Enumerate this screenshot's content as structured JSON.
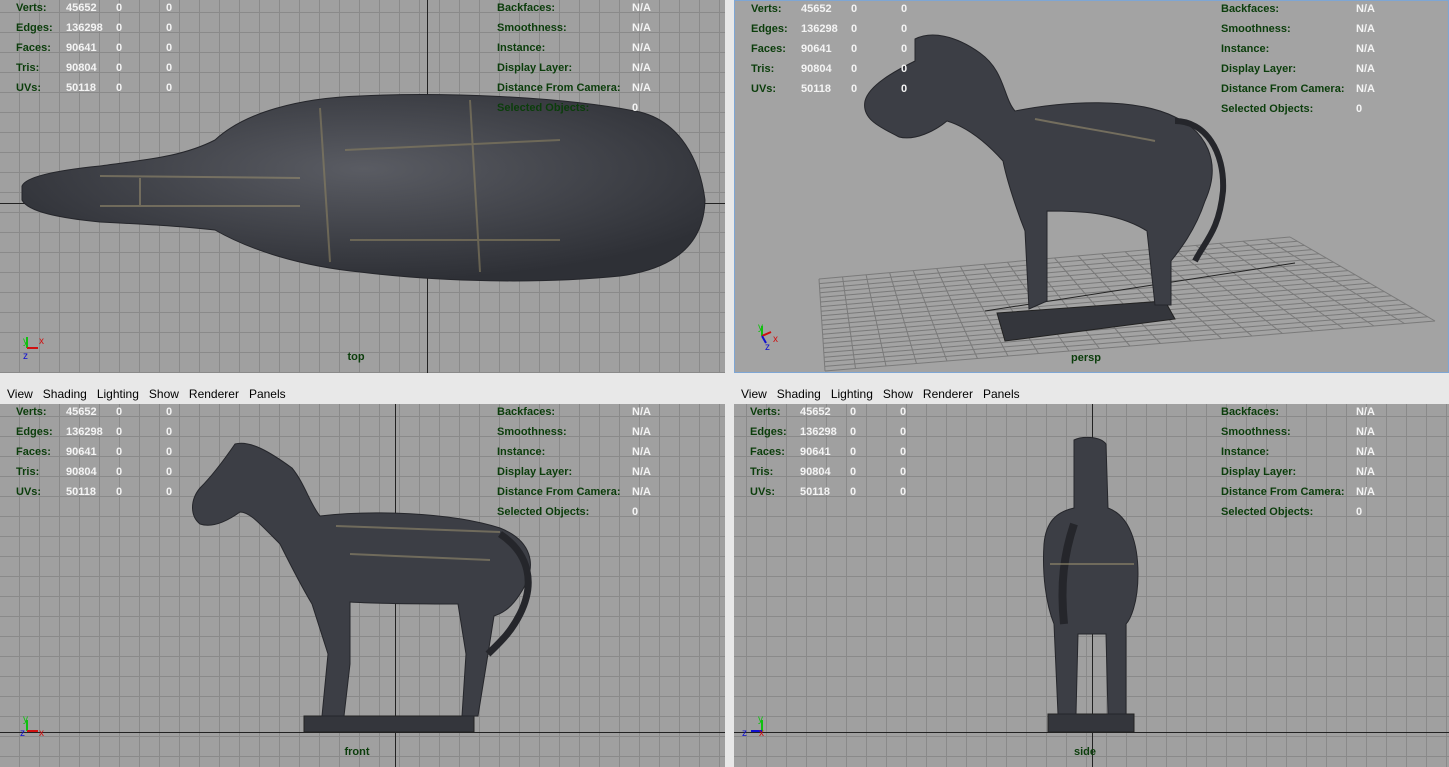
{
  "menu": [
    "View",
    "Shading",
    "Lighting",
    "Show",
    "Renderer",
    "Panels"
  ],
  "hud_left": [
    {
      "label": "Verts:",
      "v1": "45652",
      "v2": "0",
      "v3": "0"
    },
    {
      "label": "Edges:",
      "v1": "136298",
      "v2": "0",
      "v3": "0"
    },
    {
      "label": "Faces:",
      "v1": "90641",
      "v2": "0",
      "v3": "0"
    },
    {
      "label": "Tris:",
      "v1": "90804",
      "v2": "0",
      "v3": "0"
    },
    {
      "label": "UVs:",
      "v1": "50118",
      "v2": "0",
      "v3": "0"
    }
  ],
  "hud_right": [
    {
      "label": "Backfaces:",
      "value": "N/A"
    },
    {
      "label": "Smoothness:",
      "value": "N/A"
    },
    {
      "label": "Instance:",
      "value": "N/A"
    },
    {
      "label": "Display Layer:",
      "value": "N/A"
    },
    {
      "label": "Distance From Camera:",
      "value": "N/A"
    },
    {
      "label": "Selected Objects:",
      "value": "0"
    }
  ],
  "viewports": {
    "top": {
      "camera": "top"
    },
    "persp": {
      "camera": "persp"
    },
    "front": {
      "camera": "front"
    },
    "side": {
      "camera": "side"
    }
  },
  "axis": {
    "x": "x",
    "y": "y",
    "z": "z"
  },
  "colors": {
    "x_axis": "#d01010",
    "y_axis": "#10c010",
    "z_axis": "#1010d0",
    "hud_label": "#0b3d0b",
    "hud_value": "#f4f4f4",
    "model": "#3e4048"
  }
}
